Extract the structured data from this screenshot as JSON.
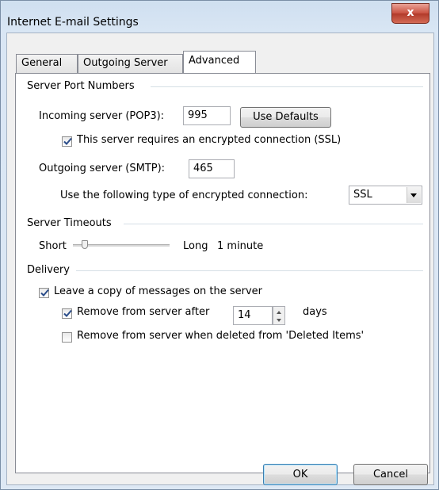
{
  "window": {
    "title": "Internet E-mail Settings",
    "close_glyph": "x"
  },
  "tabs": [
    {
      "label": "General"
    },
    {
      "label": "Outgoing Server"
    },
    {
      "label": "Advanced"
    }
  ],
  "server_ports": {
    "group_label": "Server Port Numbers",
    "incoming_label": "Incoming server (POP3):",
    "incoming_value": "995",
    "use_defaults_label": "Use Defaults",
    "ssl_checkbox_label": "This server requires an encrypted connection (SSL)",
    "ssl_checked": true,
    "outgoing_label": "Outgoing server (SMTP):",
    "outgoing_value": "465",
    "encryption_label": "Use the following type of encrypted connection:",
    "encryption_value": "SSL"
  },
  "timeouts": {
    "group_label": "Server Timeouts",
    "short_label": "Short",
    "long_label": "Long",
    "value_label": "1 minute",
    "slider_level": 0.1
  },
  "delivery": {
    "group_label": "Delivery",
    "leave_copy_label": "Leave a copy of messages on the server",
    "leave_copy_checked": true,
    "remove_after_label": "Remove from server after",
    "remove_after_checked": true,
    "remove_after_days": "14",
    "days_label": "days",
    "remove_deleted_label": "Remove from server when deleted from 'Deleted Items'",
    "remove_deleted_checked": false
  },
  "buttons": {
    "ok_label": "OK",
    "cancel_label": "Cancel"
  },
  "colors": {
    "close_button": "#c9503f",
    "panel_background": "#ffffff",
    "dialog_background": "#f0f0f0"
  }
}
